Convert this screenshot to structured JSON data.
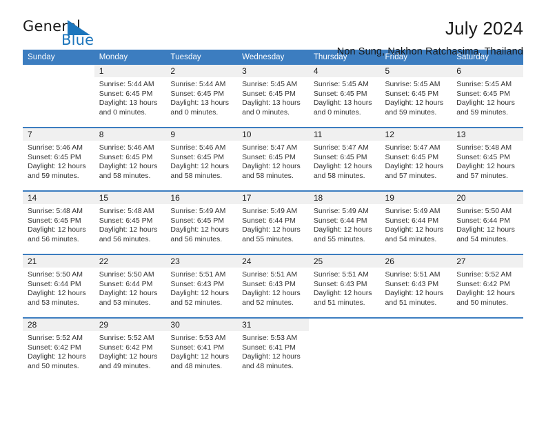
{
  "brand": {
    "name_primary": "General",
    "name_secondary": "Blue",
    "accent_color": "#1d76bc",
    "triangle_icon": "triangle-icon"
  },
  "header": {
    "title": "July 2024",
    "location": "Non Sung, Nakhon Ratchasima, Thailand"
  },
  "calendar": {
    "header_bg": "#3c7dc0",
    "daynum_bg": "#f0f0f0",
    "weekdays": [
      "Sunday",
      "Monday",
      "Tuesday",
      "Wednesday",
      "Thursday",
      "Friday",
      "Saturday"
    ],
    "weeks": [
      [
        {
          "day": "",
          "sunrise": "",
          "sunset": "",
          "daylight_1": "",
          "daylight_2": "",
          "blank": true
        },
        {
          "day": "1",
          "sunrise": "Sunrise: 5:44 AM",
          "sunset": "Sunset: 6:45 PM",
          "daylight_1": "Daylight: 13 hours",
          "daylight_2": "and 0 minutes."
        },
        {
          "day": "2",
          "sunrise": "Sunrise: 5:44 AM",
          "sunset": "Sunset: 6:45 PM",
          "daylight_1": "Daylight: 13 hours",
          "daylight_2": "and 0 minutes."
        },
        {
          "day": "3",
          "sunrise": "Sunrise: 5:45 AM",
          "sunset": "Sunset: 6:45 PM",
          "daylight_1": "Daylight: 13 hours",
          "daylight_2": "and 0 minutes."
        },
        {
          "day": "4",
          "sunrise": "Sunrise: 5:45 AM",
          "sunset": "Sunset: 6:45 PM",
          "daylight_1": "Daylight: 13 hours",
          "daylight_2": "and 0 minutes."
        },
        {
          "day": "5",
          "sunrise": "Sunrise: 5:45 AM",
          "sunset": "Sunset: 6:45 PM",
          "daylight_1": "Daylight: 12 hours",
          "daylight_2": "and 59 minutes."
        },
        {
          "day": "6",
          "sunrise": "Sunrise: 5:45 AM",
          "sunset": "Sunset: 6:45 PM",
          "daylight_1": "Daylight: 12 hours",
          "daylight_2": "and 59 minutes."
        }
      ],
      [
        {
          "day": "7",
          "sunrise": "Sunrise: 5:46 AM",
          "sunset": "Sunset: 6:45 PM",
          "daylight_1": "Daylight: 12 hours",
          "daylight_2": "and 59 minutes."
        },
        {
          "day": "8",
          "sunrise": "Sunrise: 5:46 AM",
          "sunset": "Sunset: 6:45 PM",
          "daylight_1": "Daylight: 12 hours",
          "daylight_2": "and 58 minutes."
        },
        {
          "day": "9",
          "sunrise": "Sunrise: 5:46 AM",
          "sunset": "Sunset: 6:45 PM",
          "daylight_1": "Daylight: 12 hours",
          "daylight_2": "and 58 minutes."
        },
        {
          "day": "10",
          "sunrise": "Sunrise: 5:47 AM",
          "sunset": "Sunset: 6:45 PM",
          "daylight_1": "Daylight: 12 hours",
          "daylight_2": "and 58 minutes."
        },
        {
          "day": "11",
          "sunrise": "Sunrise: 5:47 AM",
          "sunset": "Sunset: 6:45 PM",
          "daylight_1": "Daylight: 12 hours",
          "daylight_2": "and 58 minutes."
        },
        {
          "day": "12",
          "sunrise": "Sunrise: 5:47 AM",
          "sunset": "Sunset: 6:45 PM",
          "daylight_1": "Daylight: 12 hours",
          "daylight_2": "and 57 minutes."
        },
        {
          "day": "13",
          "sunrise": "Sunrise: 5:48 AM",
          "sunset": "Sunset: 6:45 PM",
          "daylight_1": "Daylight: 12 hours",
          "daylight_2": "and 57 minutes."
        }
      ],
      [
        {
          "day": "14",
          "sunrise": "Sunrise: 5:48 AM",
          "sunset": "Sunset: 6:45 PM",
          "daylight_1": "Daylight: 12 hours",
          "daylight_2": "and 56 minutes."
        },
        {
          "day": "15",
          "sunrise": "Sunrise: 5:48 AM",
          "sunset": "Sunset: 6:45 PM",
          "daylight_1": "Daylight: 12 hours",
          "daylight_2": "and 56 minutes."
        },
        {
          "day": "16",
          "sunrise": "Sunrise: 5:49 AM",
          "sunset": "Sunset: 6:45 PM",
          "daylight_1": "Daylight: 12 hours",
          "daylight_2": "and 56 minutes."
        },
        {
          "day": "17",
          "sunrise": "Sunrise: 5:49 AM",
          "sunset": "Sunset: 6:44 PM",
          "daylight_1": "Daylight: 12 hours",
          "daylight_2": "and 55 minutes."
        },
        {
          "day": "18",
          "sunrise": "Sunrise: 5:49 AM",
          "sunset": "Sunset: 6:44 PM",
          "daylight_1": "Daylight: 12 hours",
          "daylight_2": "and 55 minutes."
        },
        {
          "day": "19",
          "sunrise": "Sunrise: 5:49 AM",
          "sunset": "Sunset: 6:44 PM",
          "daylight_1": "Daylight: 12 hours",
          "daylight_2": "and 54 minutes."
        },
        {
          "day": "20",
          "sunrise": "Sunrise: 5:50 AM",
          "sunset": "Sunset: 6:44 PM",
          "daylight_1": "Daylight: 12 hours",
          "daylight_2": "and 54 minutes."
        }
      ],
      [
        {
          "day": "21",
          "sunrise": "Sunrise: 5:50 AM",
          "sunset": "Sunset: 6:44 PM",
          "daylight_1": "Daylight: 12 hours",
          "daylight_2": "and 53 minutes."
        },
        {
          "day": "22",
          "sunrise": "Sunrise: 5:50 AM",
          "sunset": "Sunset: 6:44 PM",
          "daylight_1": "Daylight: 12 hours",
          "daylight_2": "and 53 minutes."
        },
        {
          "day": "23",
          "sunrise": "Sunrise: 5:51 AM",
          "sunset": "Sunset: 6:43 PM",
          "daylight_1": "Daylight: 12 hours",
          "daylight_2": "and 52 minutes."
        },
        {
          "day": "24",
          "sunrise": "Sunrise: 5:51 AM",
          "sunset": "Sunset: 6:43 PM",
          "daylight_1": "Daylight: 12 hours",
          "daylight_2": "and 52 minutes."
        },
        {
          "day": "25",
          "sunrise": "Sunrise: 5:51 AM",
          "sunset": "Sunset: 6:43 PM",
          "daylight_1": "Daylight: 12 hours",
          "daylight_2": "and 51 minutes."
        },
        {
          "day": "26",
          "sunrise": "Sunrise: 5:51 AM",
          "sunset": "Sunset: 6:43 PM",
          "daylight_1": "Daylight: 12 hours",
          "daylight_2": "and 51 minutes."
        },
        {
          "day": "27",
          "sunrise": "Sunrise: 5:52 AM",
          "sunset": "Sunset: 6:42 PM",
          "daylight_1": "Daylight: 12 hours",
          "daylight_2": "and 50 minutes."
        }
      ],
      [
        {
          "day": "28",
          "sunrise": "Sunrise: 5:52 AM",
          "sunset": "Sunset: 6:42 PM",
          "daylight_1": "Daylight: 12 hours",
          "daylight_2": "and 50 minutes."
        },
        {
          "day": "29",
          "sunrise": "Sunrise: 5:52 AM",
          "sunset": "Sunset: 6:42 PM",
          "daylight_1": "Daylight: 12 hours",
          "daylight_2": "and 49 minutes."
        },
        {
          "day": "30",
          "sunrise": "Sunrise: 5:53 AM",
          "sunset": "Sunset: 6:41 PM",
          "daylight_1": "Daylight: 12 hours",
          "daylight_2": "and 48 minutes."
        },
        {
          "day": "31",
          "sunrise": "Sunrise: 5:53 AM",
          "sunset": "Sunset: 6:41 PM",
          "daylight_1": "Daylight: 12 hours",
          "daylight_2": "and 48 minutes."
        },
        {
          "day": "",
          "sunrise": "",
          "sunset": "",
          "daylight_1": "",
          "daylight_2": "",
          "blank": true
        },
        {
          "day": "",
          "sunrise": "",
          "sunset": "",
          "daylight_1": "",
          "daylight_2": "",
          "blank": true
        },
        {
          "day": "",
          "sunrise": "",
          "sunset": "",
          "daylight_1": "",
          "daylight_2": "",
          "blank": true
        }
      ]
    ]
  }
}
